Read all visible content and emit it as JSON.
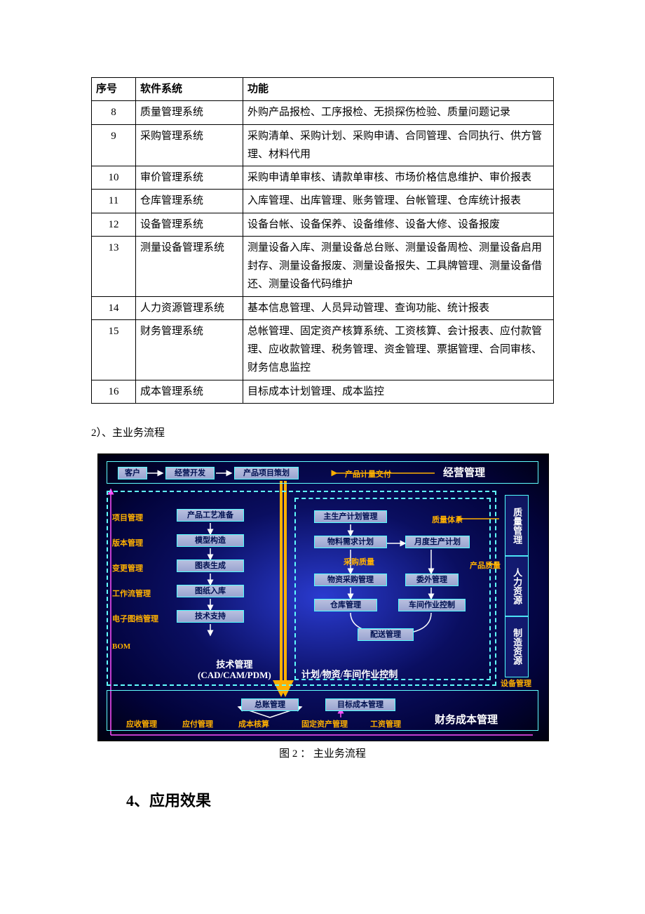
{
  "table": {
    "headers": [
      "序号",
      "软件系统",
      "功能"
    ],
    "rows": [
      {
        "seq": "8",
        "sys": "质量管理系统",
        "func": "外购产品报检、工序报检、无损探伤检验、质量问题记录"
      },
      {
        "seq": "9",
        "sys": "采购管理系统",
        "func": "采购清单、采购计划、采购申请、合同管理、合同执行、供方管理、材料代用"
      },
      {
        "seq": "10",
        "sys": "审价管理系统",
        "func": "采购申请单审核、请款单审核、市场价格信息维护、审价报表"
      },
      {
        "seq": "11",
        "sys": "仓库管理系统",
        "func": "入库管理、出库管理、账务管理、台帐管理、仓库统计报表"
      },
      {
        "seq": "12",
        "sys": "设备管理系统",
        "func": "设备台帐、设备保养、设备维修、设备大修、设备报废"
      },
      {
        "seq": "13",
        "sys": "测量设备管理系统",
        "func": "测量设备入库、测量设备总台账、测量设备周检、测量设备启用封存、测量设备报废、测量设备报失、工具牌管理、测量设备借还、测量设备代码维护"
      },
      {
        "seq": "14",
        "sys": "人力资源管理系统",
        "func": "基本信息管理、人员异动管理、查询功能、统计报表"
      },
      {
        "seq": "15",
        "sys": "财务管理系统",
        "func": "总帐管理、固定资产核算系统、工资核算、会计报表、应付款管理、应收款管理、税务管理、资金管理、票据管理、合同审核、财务信息监控"
      },
      {
        "seq": "16",
        "sys": "成本管理系统",
        "func": "目标成本计划管理、成本监控"
      }
    ]
  },
  "section_sub": "2）、主业务流程",
  "diagram": {
    "top_row": {
      "customer": "客户",
      "biz_dev": "经营开发",
      "product_plan": "产品项目策划",
      "delivery": "产品计量交付",
      "biz_mgmt": "经营管理"
    },
    "left_labels": {
      "project": "项目管理",
      "version": "版本管理",
      "change": "变更管理",
      "workflow": "工作流管理",
      "edoc": "电子图档管理",
      "bom": "BOM"
    },
    "left_boxes": {
      "process_prep": "产品工艺准备",
      "model_build": "模型构造",
      "chart_gen": "图表生成",
      "drawing_store": "图纸入库",
      "tech_support": "技术支持"
    },
    "tech_mgmt": "技术管理\n(CAD/CAM/PDM)",
    "mid_boxes": {
      "master_plan": "主生产计划管理",
      "mrp": "物料需求计划",
      "monthly_plan": "月度生产计划",
      "purchase_quality": "采购质量",
      "material_purchase": "物资采购管理",
      "outsource": "委外管理",
      "warehouse": "仓库管理",
      "workshop": "车间作业控制",
      "delivery_mgmt": "配送管理"
    },
    "mid_label": "计划/物资/车间作业控制",
    "quality_system": "质量体系",
    "product_quality": "产品质量",
    "right_panels": {
      "quality": "质量管理",
      "hr": "人力资源",
      "mfg_res": "制造资源"
    },
    "equipment": "设备管理",
    "bottom": {
      "gl": "总账管理",
      "target_cost": "目标成本管理",
      "ar": "应收管理",
      "ap": "应付管理",
      "cost_calc": "成本核算",
      "fixed_asset": "固定资产管理",
      "salary": "工资管理",
      "fin_cost": "财务成本管理"
    }
  },
  "caption": "图 2 ：  主业务流程",
  "heading4": "4、应用效果"
}
